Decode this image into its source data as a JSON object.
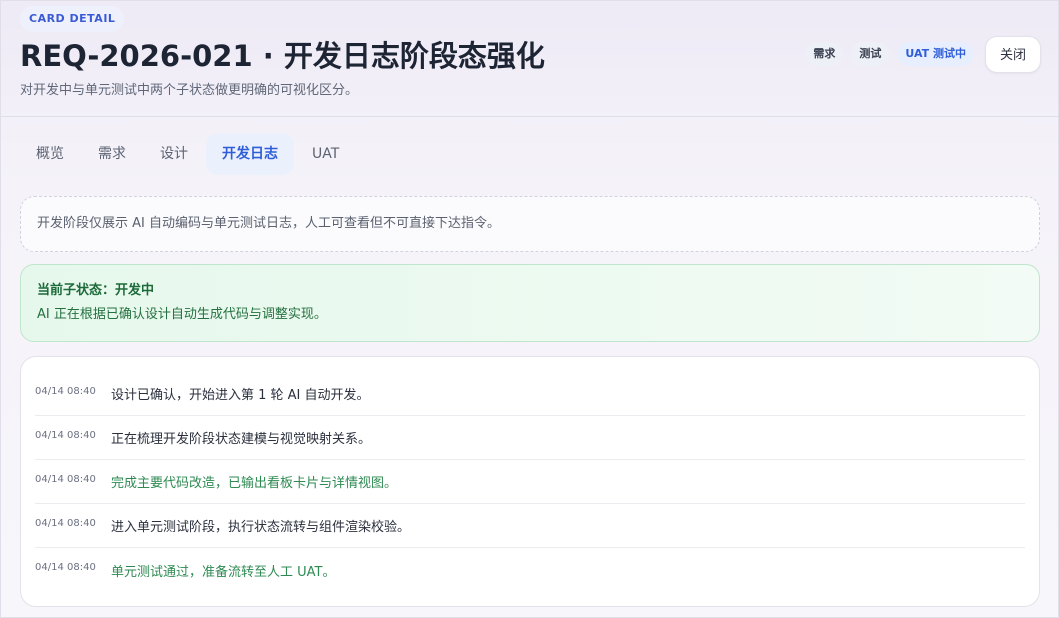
{
  "header": {
    "eyebrow": "CARD DETAIL",
    "title": "REQ-2026-021 · 开发日志阶段态强化",
    "subtitle": "对开发中与单元测试中两个子状态做更明确的可视化区分。",
    "badges": [
      {
        "label": "需求"
      },
      {
        "label": "测试"
      },
      {
        "label": "UAT 测试中"
      }
    ],
    "close_label": "关闭"
  },
  "tabs": [
    {
      "label": "概览"
    },
    {
      "label": "需求"
    },
    {
      "label": "设计"
    },
    {
      "label": "开发日志"
    },
    {
      "label": "UAT"
    }
  ],
  "active_tab": "开发日志",
  "notice": "开发阶段仅展示 AI 自动编码与单元测试日志，人工可查看但不可直接下达指令。",
  "status": {
    "title": "当前子状态：开发中",
    "description": "AI 正在根据已确认设计自动生成代码与调整实现。"
  },
  "logs": [
    {
      "time": "04/14 08:40",
      "text": "设计已确认，开始进入第 1 轮 AI 自动开发。",
      "tone": "normal"
    },
    {
      "time": "04/14 08:40",
      "text": "正在梳理开发阶段状态建模与视觉映射关系。",
      "tone": "normal"
    },
    {
      "time": "04/14 08:40",
      "text": "完成主要代码改造，已输出看板卡片与详情视图。",
      "tone": "success"
    },
    {
      "time": "04/14 08:40",
      "text": "进入单元测试阶段，执行状态流转与组件渲染校验。",
      "tone": "normal"
    },
    {
      "time": "04/14 08:40",
      "text": "单元测试通过，准备流转至人工 UAT。",
      "tone": "success"
    }
  ],
  "colors": {
    "accent": "#2f5ed8",
    "success": "#2e8a52",
    "status_bg": "#e6f8ec"
  }
}
